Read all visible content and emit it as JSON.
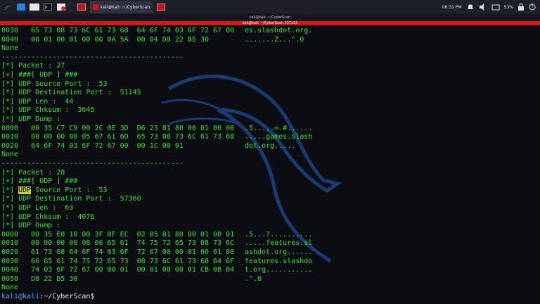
{
  "taskbar": {
    "windows": [
      {
        "label": ""
      },
      {
        "label": "kali@kali: ~/CyberScan"
      },
      {
        "label": ""
      }
    ],
    "clock": "06:31 PM",
    "battery": "53%"
  },
  "window": {
    "title": "kali@kali: ~/CyberScan",
    "subtitle": "kali@kali: ~/CyberScan 127x31"
  },
  "terminal": {
    "lines": [
      {
        "text": "0030   65 73 08 73 6C 61 73 68  64 6F 74 03 6F 72 67 00",
        "ascii": "es.slashdot.org."
      },
      {
        "text": "0040   00 01 00 01 00 00 0A 5A  00 04 D8 22 B5 30",
        "ascii": ".......Z...\".0"
      },
      {
        "text": "None",
        "ascii": ""
      },
      {
        "text": "-------------------------------------------",
        "ascii": ""
      },
      {
        "text": "[*] Packet : 27",
        "ascii": ""
      },
      {
        "text": "[+] ###[ UDP ] ###",
        "ascii": ""
      },
      {
        "text": "[*] UDP Source Port :  53",
        "ascii": ""
      },
      {
        "text": "[*] UDP Destination Port :  51145",
        "ascii": ""
      },
      {
        "text": "[*] UDP Len :  44",
        "ascii": ""
      },
      {
        "text": "[*] UDP Chksum :  3645",
        "ascii": ""
      },
      {
        "text": "[*] UDP Dump :",
        "ascii": ""
      },
      {
        "text": "0000   00 35 C7 C9 00 2C 0E 3D  D6 23 81 80 00 01 00 00",
        "ascii": ".5...,.=.#......"
      },
      {
        "text": "0010   00 00 00 00 05 67 61 6D  65 73 08 73 6C 61 73 68",
        "ascii": ".....games.slash"
      },
      {
        "text": "0020   64 6F 74 03 6F 72 67 00  00 1C 00 01",
        "ascii": "dot.org....."
      },
      {
        "text": "None",
        "ascii": ""
      },
      {
        "text": "-------------------------------------------",
        "ascii": ""
      },
      {
        "text": "[*] Packet : 28",
        "ascii": ""
      },
      {
        "text": "[+] ###[ UDP ] ###",
        "ascii": ""
      },
      {
        "text": "[*] UDP Source Port :  53",
        "ascii": ""
      },
      {
        "text": "[*] UDP Destination Port :  57360",
        "ascii": ""
      },
      {
        "text": "[*] UDP Len :  63",
        "ascii": ""
      },
      {
        "text": "[*] UDP Chksum :  4076",
        "ascii": ""
      },
      {
        "text": "[*] UDP Dump :",
        "ascii": ""
      },
      {
        "text": "0000   00 35 E0 10 00 3F 0F EC  02 05 81 80 00 01 00 01",
        "ascii": ".5...?.........."
      },
      {
        "text": "0010   00 00 00 00 08 66 65 61  74 75 72 65 73 08 73 6C",
        "ascii": ".....features.sl"
      },
      {
        "text": "0020   61 73 68 64 6F 74 03 6F  72 67 00 00 01 00 01 08",
        "ascii": "ashdot.org......"
      },
      {
        "text": "0030   66 65 61 74 75 72 65 73  08 73 6C 61 73 68 64 6F",
        "ascii": "features.slashdo"
      },
      {
        "text": "0040   74 03 6F 72 67 00 00 01  00 01 00 00 01 CB 00 04",
        "ascii": "t.org..........."
      },
      {
        "text": "0050   D8 22 B5 30",
        "ascii": ".\".0"
      },
      {
        "text": "None",
        "ascii": ""
      }
    ],
    "highlight_word": "UDP",
    "prompt": {
      "user": "kali@kali",
      "path": ":~/CyberScan$"
    }
  }
}
